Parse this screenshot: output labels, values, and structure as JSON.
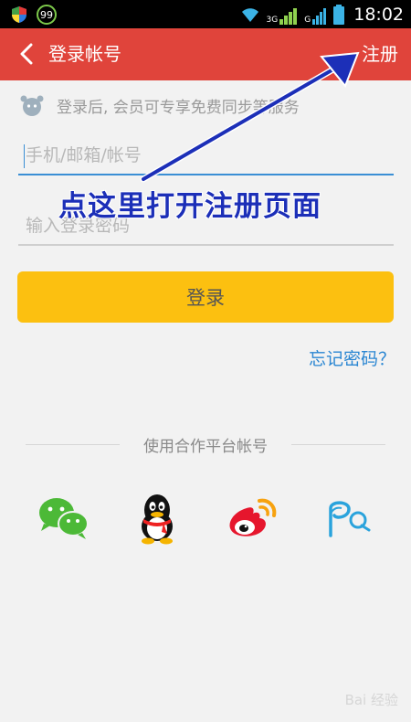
{
  "status_bar": {
    "time": "18:02",
    "net_badge": "99",
    "signal_label": "3G",
    "signal_label2": "G"
  },
  "header": {
    "title": "登录帐号",
    "register": "注册"
  },
  "login": {
    "hint": "登录后, 会员可专享免费同步等服务",
    "account_placeholder": "手机/邮箱/帐号",
    "password_placeholder": "输入登录密码",
    "login_button": "登录",
    "forgot_password": "忘记密码？"
  },
  "partners": {
    "heading": "使用合作平台帐号",
    "items": [
      "wechat-icon",
      "qq-icon",
      "weibo-icon",
      "pp-icon"
    ]
  },
  "annotation": {
    "text": "点这里打开注册页面"
  },
  "watermark": {
    "text": "Bai 经验"
  },
  "colors": {
    "header_bg": "#e0443b",
    "login_button": "#fcc010",
    "link": "#2a86d2",
    "annotation": "#1c2fb8"
  }
}
